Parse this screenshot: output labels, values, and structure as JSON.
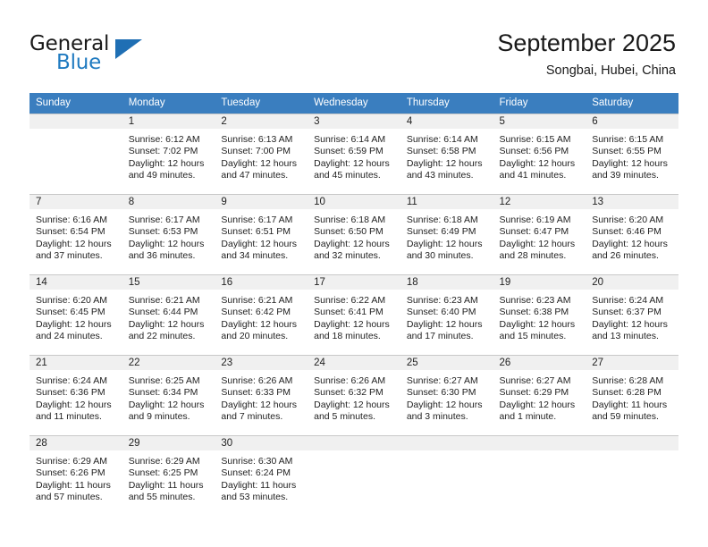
{
  "brand": {
    "name_part1": "General",
    "name_part2": "Blue",
    "triangle_color": "#1f6fb4",
    "blue_color": "#1f7ac0"
  },
  "header": {
    "title": "September 2025",
    "subtitle": "Songbai, Hubei, China"
  },
  "theme": {
    "header_row_bg": "#3a7ebf",
    "daynum_bg": "#f0f0f0",
    "grid_line": "#c8c8c8",
    "text": "#222222"
  },
  "weekdays": [
    "Sunday",
    "Monday",
    "Tuesday",
    "Wednesday",
    "Thursday",
    "Friday",
    "Saturday"
  ],
  "labels": {
    "sunrise_prefix": "Sunrise:",
    "sunset_prefix": "Sunset:",
    "daylight_prefix": "Daylight:"
  },
  "weeks": [
    [
      {
        "day": "",
        "empty": true,
        "sunrise": "",
        "sunset": "",
        "daylight_line1": "",
        "daylight_line2": ""
      },
      {
        "day": "1",
        "sunrise": "Sunrise: 6:12 AM",
        "sunset": "Sunset: 7:02 PM",
        "daylight_line1": "Daylight: 12 hours",
        "daylight_line2": "and 49 minutes."
      },
      {
        "day": "2",
        "sunrise": "Sunrise: 6:13 AM",
        "sunset": "Sunset: 7:00 PM",
        "daylight_line1": "Daylight: 12 hours",
        "daylight_line2": "and 47 minutes."
      },
      {
        "day": "3",
        "sunrise": "Sunrise: 6:14 AM",
        "sunset": "Sunset: 6:59 PM",
        "daylight_line1": "Daylight: 12 hours",
        "daylight_line2": "and 45 minutes."
      },
      {
        "day": "4",
        "sunrise": "Sunrise: 6:14 AM",
        "sunset": "Sunset: 6:58 PM",
        "daylight_line1": "Daylight: 12 hours",
        "daylight_line2": "and 43 minutes."
      },
      {
        "day": "5",
        "sunrise": "Sunrise: 6:15 AM",
        "sunset": "Sunset: 6:56 PM",
        "daylight_line1": "Daylight: 12 hours",
        "daylight_line2": "and 41 minutes."
      },
      {
        "day": "6",
        "sunrise": "Sunrise: 6:15 AM",
        "sunset": "Sunset: 6:55 PM",
        "daylight_line1": "Daylight: 12 hours",
        "daylight_line2": "and 39 minutes."
      }
    ],
    [
      {
        "day": "7",
        "sunrise": "Sunrise: 6:16 AM",
        "sunset": "Sunset: 6:54 PM",
        "daylight_line1": "Daylight: 12 hours",
        "daylight_line2": "and 37 minutes."
      },
      {
        "day": "8",
        "sunrise": "Sunrise: 6:17 AM",
        "sunset": "Sunset: 6:53 PM",
        "daylight_line1": "Daylight: 12 hours",
        "daylight_line2": "and 36 minutes."
      },
      {
        "day": "9",
        "sunrise": "Sunrise: 6:17 AM",
        "sunset": "Sunset: 6:51 PM",
        "daylight_line1": "Daylight: 12 hours",
        "daylight_line2": "and 34 minutes."
      },
      {
        "day": "10",
        "sunrise": "Sunrise: 6:18 AM",
        "sunset": "Sunset: 6:50 PM",
        "daylight_line1": "Daylight: 12 hours",
        "daylight_line2": "and 32 minutes."
      },
      {
        "day": "11",
        "sunrise": "Sunrise: 6:18 AM",
        "sunset": "Sunset: 6:49 PM",
        "daylight_line1": "Daylight: 12 hours",
        "daylight_line2": "and 30 minutes."
      },
      {
        "day": "12",
        "sunrise": "Sunrise: 6:19 AM",
        "sunset": "Sunset: 6:47 PM",
        "daylight_line1": "Daylight: 12 hours",
        "daylight_line2": "and 28 minutes."
      },
      {
        "day": "13",
        "sunrise": "Sunrise: 6:20 AM",
        "sunset": "Sunset: 6:46 PM",
        "daylight_line1": "Daylight: 12 hours",
        "daylight_line2": "and 26 minutes."
      }
    ],
    [
      {
        "day": "14",
        "sunrise": "Sunrise: 6:20 AM",
        "sunset": "Sunset: 6:45 PM",
        "daylight_line1": "Daylight: 12 hours",
        "daylight_line2": "and 24 minutes."
      },
      {
        "day": "15",
        "sunrise": "Sunrise: 6:21 AM",
        "sunset": "Sunset: 6:44 PM",
        "daylight_line1": "Daylight: 12 hours",
        "daylight_line2": "and 22 minutes."
      },
      {
        "day": "16",
        "sunrise": "Sunrise: 6:21 AM",
        "sunset": "Sunset: 6:42 PM",
        "daylight_line1": "Daylight: 12 hours",
        "daylight_line2": "and 20 minutes."
      },
      {
        "day": "17",
        "sunrise": "Sunrise: 6:22 AM",
        "sunset": "Sunset: 6:41 PM",
        "daylight_line1": "Daylight: 12 hours",
        "daylight_line2": "and 18 minutes."
      },
      {
        "day": "18",
        "sunrise": "Sunrise: 6:23 AM",
        "sunset": "Sunset: 6:40 PM",
        "daylight_line1": "Daylight: 12 hours",
        "daylight_line2": "and 17 minutes."
      },
      {
        "day": "19",
        "sunrise": "Sunrise: 6:23 AM",
        "sunset": "Sunset: 6:38 PM",
        "daylight_line1": "Daylight: 12 hours",
        "daylight_line2": "and 15 minutes."
      },
      {
        "day": "20",
        "sunrise": "Sunrise: 6:24 AM",
        "sunset": "Sunset: 6:37 PM",
        "daylight_line1": "Daylight: 12 hours",
        "daylight_line2": "and 13 minutes."
      }
    ],
    [
      {
        "day": "21",
        "sunrise": "Sunrise: 6:24 AM",
        "sunset": "Sunset: 6:36 PM",
        "daylight_line1": "Daylight: 12 hours",
        "daylight_line2": "and 11 minutes."
      },
      {
        "day": "22",
        "sunrise": "Sunrise: 6:25 AM",
        "sunset": "Sunset: 6:34 PM",
        "daylight_line1": "Daylight: 12 hours",
        "daylight_line2": "and 9 minutes."
      },
      {
        "day": "23",
        "sunrise": "Sunrise: 6:26 AM",
        "sunset": "Sunset: 6:33 PM",
        "daylight_line1": "Daylight: 12 hours",
        "daylight_line2": "and 7 minutes."
      },
      {
        "day": "24",
        "sunrise": "Sunrise: 6:26 AM",
        "sunset": "Sunset: 6:32 PM",
        "daylight_line1": "Daylight: 12 hours",
        "daylight_line2": "and 5 minutes."
      },
      {
        "day": "25",
        "sunrise": "Sunrise: 6:27 AM",
        "sunset": "Sunset: 6:30 PM",
        "daylight_line1": "Daylight: 12 hours",
        "daylight_line2": "and 3 minutes."
      },
      {
        "day": "26",
        "sunrise": "Sunrise: 6:27 AM",
        "sunset": "Sunset: 6:29 PM",
        "daylight_line1": "Daylight: 12 hours",
        "daylight_line2": "and 1 minute."
      },
      {
        "day": "27",
        "sunrise": "Sunrise: 6:28 AM",
        "sunset": "Sunset: 6:28 PM",
        "daylight_line1": "Daylight: 11 hours",
        "daylight_line2": "and 59 minutes."
      }
    ],
    [
      {
        "day": "28",
        "sunrise": "Sunrise: 6:29 AM",
        "sunset": "Sunset: 6:26 PM",
        "daylight_line1": "Daylight: 11 hours",
        "daylight_line2": "and 57 minutes."
      },
      {
        "day": "29",
        "sunrise": "Sunrise: 6:29 AM",
        "sunset": "Sunset: 6:25 PM",
        "daylight_line1": "Daylight: 11 hours",
        "daylight_line2": "and 55 minutes."
      },
      {
        "day": "30",
        "sunrise": "Sunrise: 6:30 AM",
        "sunset": "Sunset: 6:24 PM",
        "daylight_line1": "Daylight: 11 hours",
        "daylight_line2": "and 53 minutes."
      },
      {
        "day": "",
        "empty": true,
        "sunrise": "",
        "sunset": "",
        "daylight_line1": "",
        "daylight_line2": ""
      },
      {
        "day": "",
        "empty": true,
        "sunrise": "",
        "sunset": "",
        "daylight_line1": "",
        "daylight_line2": ""
      },
      {
        "day": "",
        "empty": true,
        "sunrise": "",
        "sunset": "",
        "daylight_line1": "",
        "daylight_line2": ""
      },
      {
        "day": "",
        "empty": true,
        "sunrise": "",
        "sunset": "",
        "daylight_line1": "",
        "daylight_line2": ""
      }
    ]
  ]
}
